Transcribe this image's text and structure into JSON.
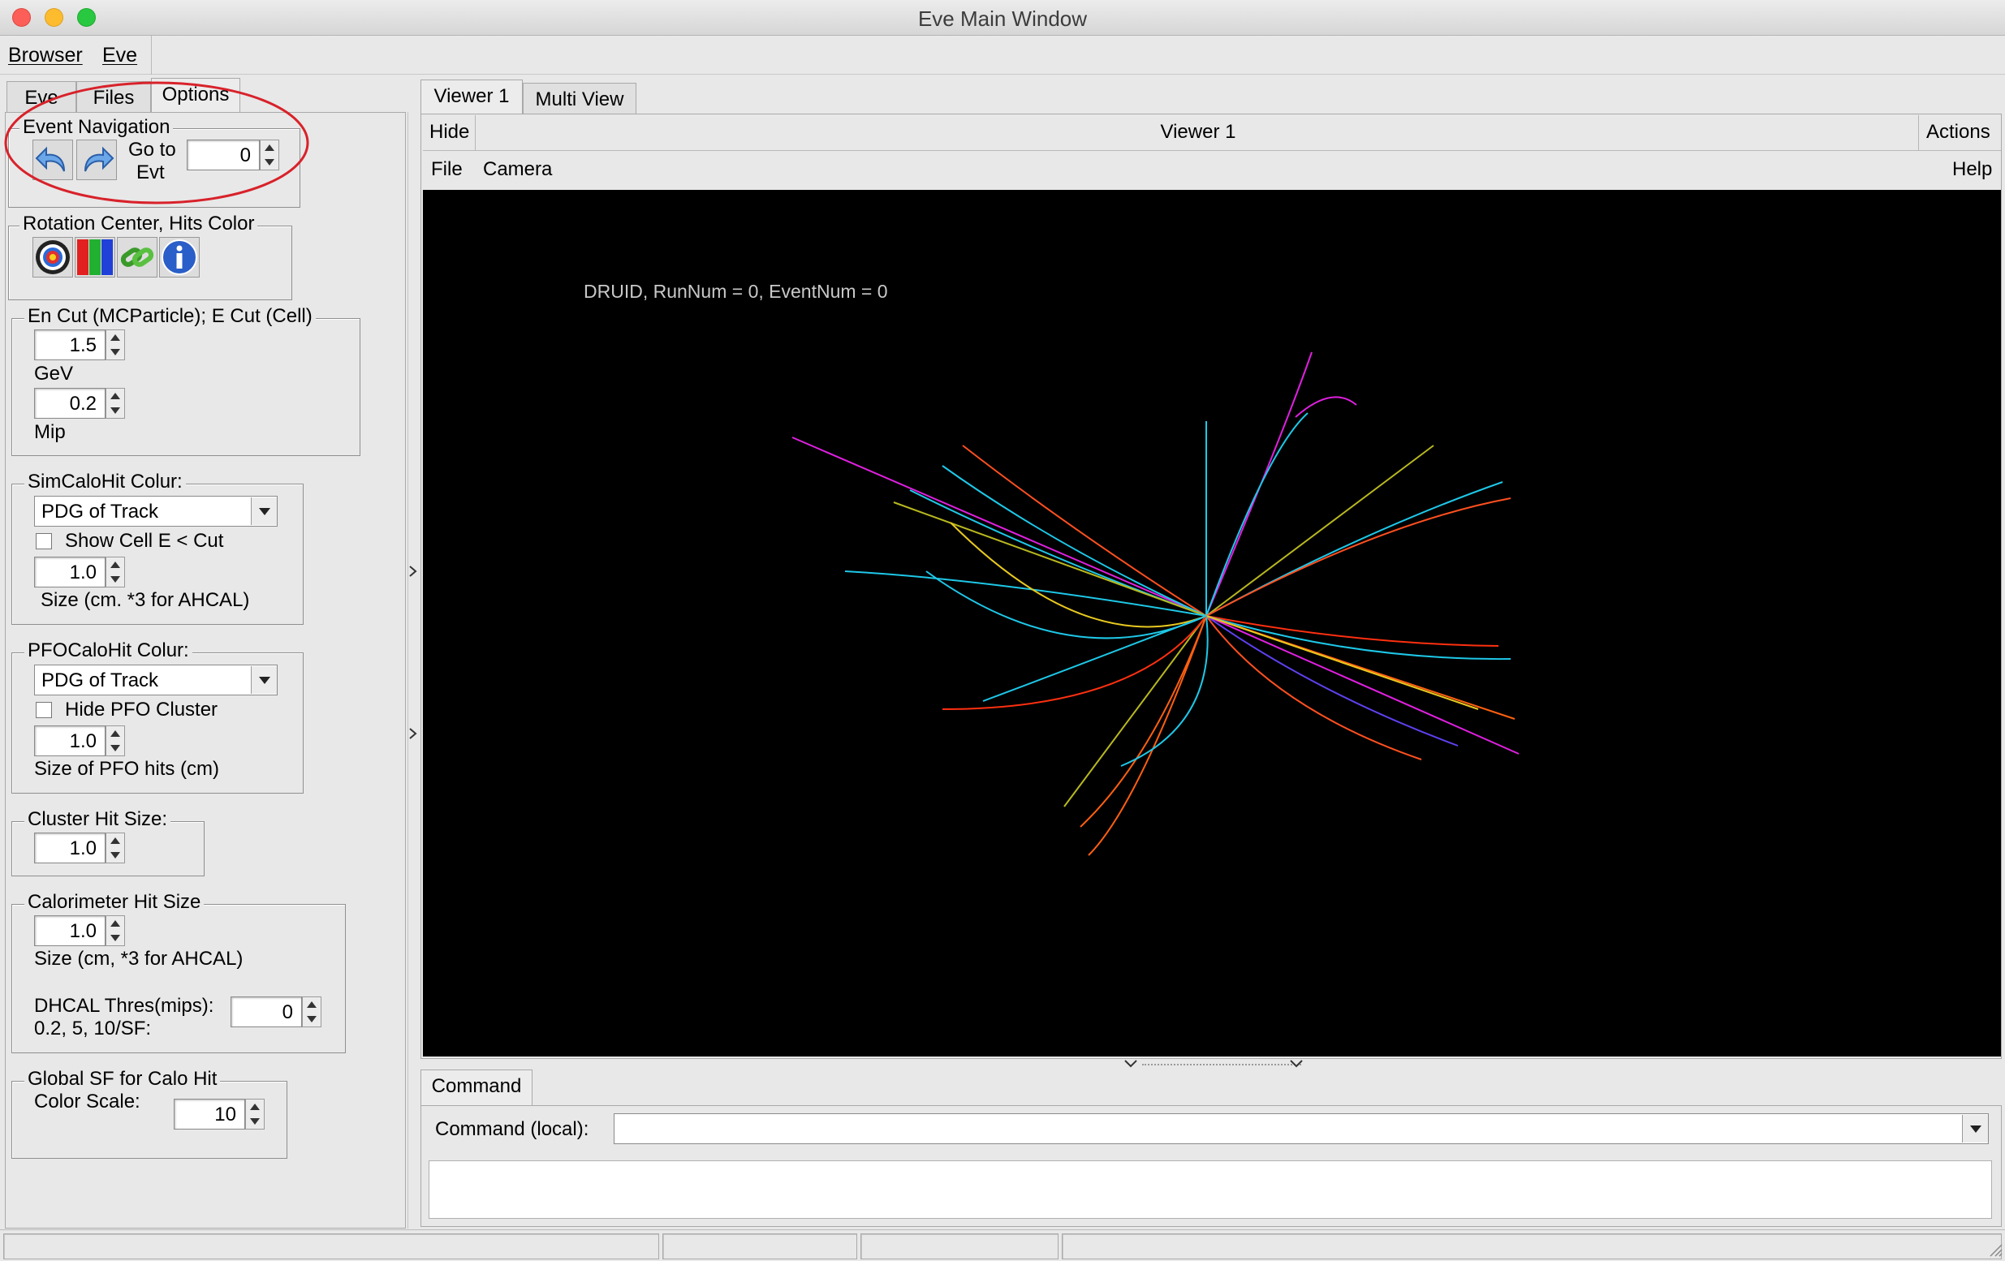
{
  "window": {
    "title": "Eve Main Window"
  },
  "menubar": {
    "items": [
      "Browser",
      "Eve"
    ]
  },
  "left_tabs": [
    "Eve",
    "Files",
    "Options"
  ],
  "event_navigation": {
    "title": "Event Navigation",
    "goto_label_1": "Go to",
    "goto_label_2": "Evt",
    "event_number": "0"
  },
  "rotation": {
    "title": "Rotation Center, Hits Color"
  },
  "en_cut": {
    "title": "En Cut (MCParticle); E Cut (Cell)",
    "value1": "1.5",
    "unit1": "GeV",
    "value2": "0.2",
    "unit2": "Mip"
  },
  "sim_calo": {
    "title": "SimCaloHit Colur:",
    "combo_value": "PDG of Track",
    "checkbox_label": "Show Cell E < Cut",
    "size_value": "1.0",
    "size_label": "Size (cm. *3 for AHCAL)"
  },
  "pfo_calo": {
    "title": "PFOCaloHit Colur:",
    "combo_value": "PDG of Track",
    "checkbox_label": "Hide PFO Cluster",
    "size_value": "1.0",
    "size_label": "Size of PFO hits (cm)"
  },
  "cluster_hit": {
    "title": "Cluster Hit Size:",
    "value": "1.0"
  },
  "calorimeter_hit": {
    "title": "Calorimeter Hit Size",
    "value": "1.0",
    "size_label": "Size (cm, *3 for AHCAL)",
    "dhcal_label_1": "DHCAL Thres(mips):",
    "dhcal_label_2": "0.2, 5, 10/SF:",
    "dhcal_value": "0"
  },
  "global_sf": {
    "title": "Global SF for Calo Hit",
    "label": "Color Scale:",
    "value": "10"
  },
  "viewer_tabs": [
    "Viewer 1",
    "Multi View"
  ],
  "viewer_bar": {
    "hide": "Hide",
    "title": "Viewer 1",
    "actions": "Actions"
  },
  "viewer_menu": {
    "file": "File",
    "camera": "Camera",
    "help": "Help"
  },
  "viewer": {
    "overlay_text": "DRUID, RunNum = 0, EventNum = 0",
    "colors": {
      "background": "#000000",
      "overlay_text": "#c8c8c8",
      "annotation": "#d8222a"
    }
  },
  "command": {
    "tab": "Command",
    "label": "Command (local):",
    "input_value": ""
  }
}
